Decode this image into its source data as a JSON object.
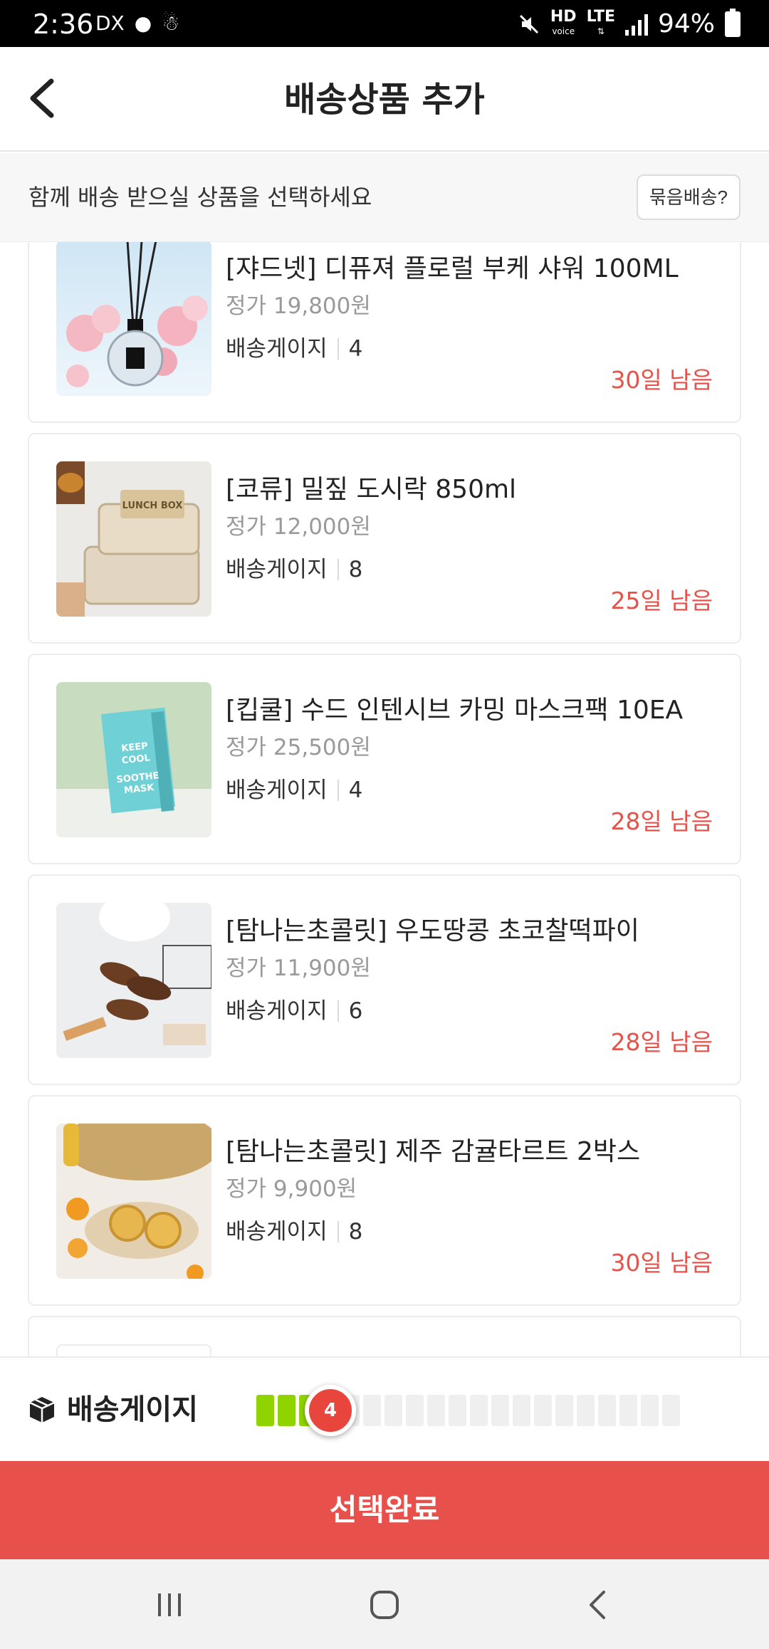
{
  "status": {
    "time": "2:36",
    "left_icons": [
      "DX",
      "●",
      "☃"
    ],
    "hd_label": "HD",
    "hd_sub": "voice",
    "lte_label": "LTE",
    "battery": "94%"
  },
  "header": {
    "title": "배송상품 추가"
  },
  "instruction": {
    "text": "함께 배송 받으실 상품을 선택하세요",
    "bundle_button": "묶음배송?"
  },
  "products": [
    {
      "name": "[쟈드넷] 디퓨져 플로럴 부케 샤워 100ML",
      "price": "정가 19,800원",
      "gauge_label": "배송게이지",
      "gauge_value": "4",
      "days_left": "30일 남음",
      "image": "diffuser-image"
    },
    {
      "name": "[코류] 밀짚 도시락 850ml",
      "price": "정가 12,000원",
      "gauge_label": "배송게이지",
      "gauge_value": "8",
      "days_left": "25일 남음",
      "image": "lunchbox-image"
    },
    {
      "name": "[킵쿨] 수드 인텐시브 카밍 마스크팩 10EA",
      "price": "정가 25,500원",
      "gauge_label": "배송게이지",
      "gauge_value": "4",
      "days_left": "28일 남음",
      "image": "maskpack-image"
    },
    {
      "name": "[탐나는초콜릿] 우도땅콩 초코찰떡파이",
      "price": "정가 11,900원",
      "gauge_label": "배송게이지",
      "gauge_value": "6",
      "days_left": "28일 남음",
      "image": "chocopie-image"
    },
    {
      "name": "[탐나는초콜릿] 제주 감귤타르트 2박스",
      "price": "정가 9,900원",
      "gauge_label": "배송게이지",
      "gauge_value": "8",
      "days_left": "30일 남음",
      "image": "tart-image"
    }
  ],
  "mask_box_text": [
    "KEEP",
    "COOL",
    "SOOTHE",
    "MASK"
  ],
  "lunchbox_text": "LUNCH BOX",
  "gauge": {
    "label": "배송게이지",
    "current": "4",
    "filled_segments": 4,
    "total_segments": 20,
    "fill_color": "#8fd400"
  },
  "confirm": {
    "label": "선택완료"
  },
  "colors": {
    "accent": "#e8514b",
    "days_left": "#e5534b",
    "gauge_on": "#8fd400"
  }
}
